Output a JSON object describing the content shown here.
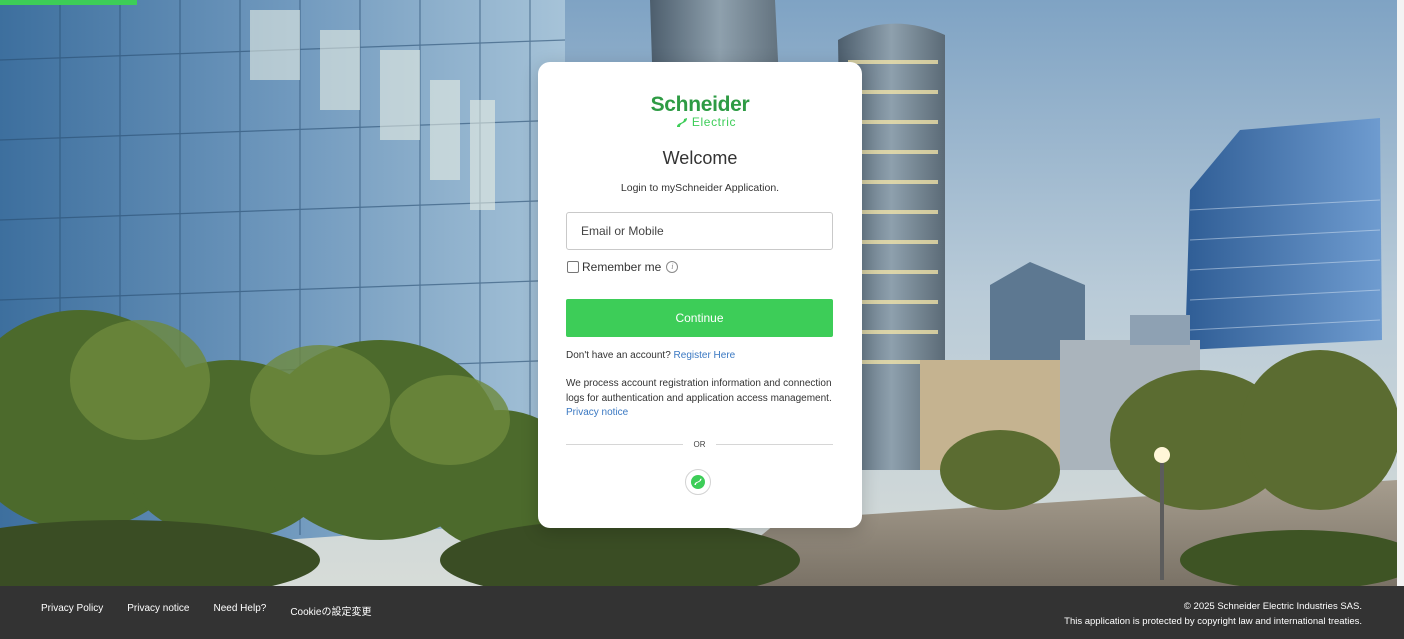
{
  "brand": {
    "name": "Schneider",
    "sub": "Electric",
    "accent_color": "#3dcd58"
  },
  "login": {
    "title": "Welcome",
    "subtitle": "Login to mySchneider Application.",
    "email_placeholder": "Email or Mobile",
    "remember_label": "Remember me",
    "continue_label": "Continue",
    "no_account_text": "Don't have an account?",
    "register_link": "Register Here",
    "privacy_text": "We process account registration information and connection logs for authentication and application access management.",
    "privacy_link": "Privacy notice",
    "or_label": "OR"
  },
  "footer": {
    "links": [
      "Privacy Policy",
      "Privacy notice",
      "Need Help?",
      "Cookieの設定変更"
    ],
    "copyright": "© 2025 Schneider Electric Industries SAS.",
    "protection": "This application is protected by copyright law and international treaties."
  }
}
